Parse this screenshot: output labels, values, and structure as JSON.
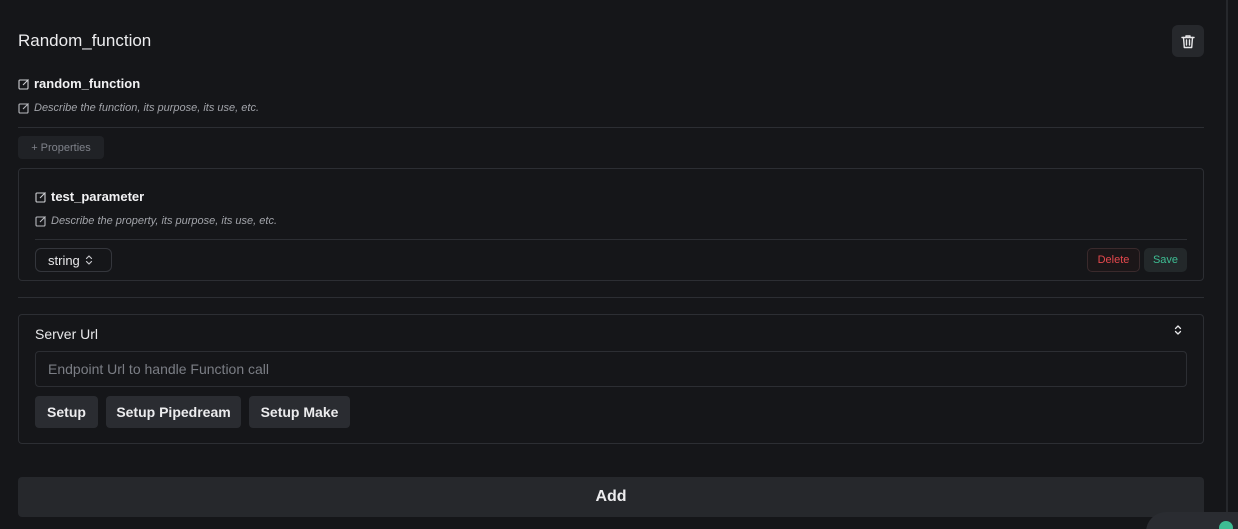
{
  "function": {
    "title": "Random_function",
    "name": "random_function",
    "description_placeholder": "Describe the function, its purpose, its use, etc.",
    "properties_button": "+ Properties"
  },
  "property": {
    "name": "test_parameter",
    "description_placeholder": "Describe the property, its purpose, its use, etc.",
    "type": "string",
    "delete_label": "Delete",
    "save_label": "Save"
  },
  "server": {
    "label": "Server Url",
    "input_placeholder": "Endpoint Url to handle Function call",
    "input_value": "",
    "buttons": [
      "Setup",
      "Setup Pipedream",
      "Setup Make"
    ]
  },
  "add_label": "Add",
  "colors": {
    "background": "#151619",
    "danger": "#e5484d",
    "success": "#3ebd93"
  },
  "icons": [
    "trash-icon",
    "edit-icon",
    "chevron-updown-icon"
  ]
}
